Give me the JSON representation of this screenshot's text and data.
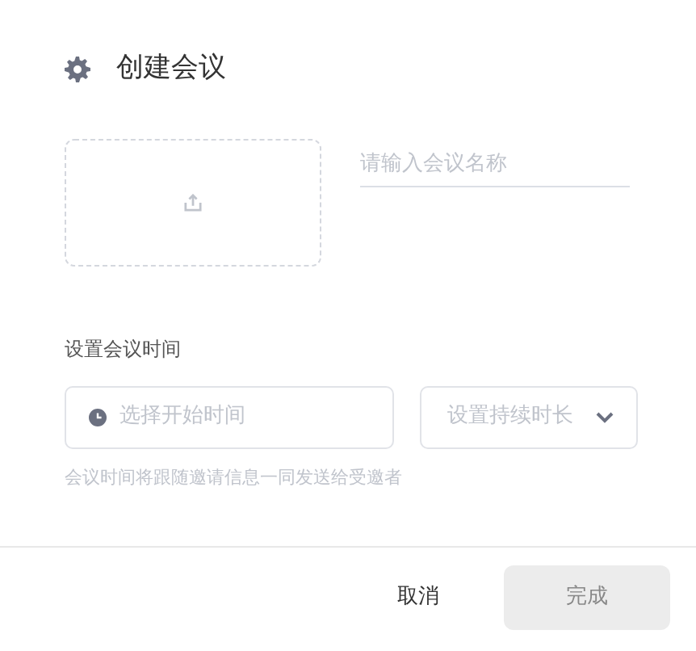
{
  "dialog": {
    "title": "创建会议"
  },
  "name_field": {
    "placeholder": "请输入会议名称"
  },
  "time_section": {
    "label": "设置会议时间",
    "start_field": {
      "placeholder": "选择开始时间"
    },
    "duration_select": {
      "placeholder": "设置持续时长"
    },
    "hint": "会议时间将跟随邀请信息一同发送给受邀者"
  },
  "buttons": [
    {
      "label": "取消",
      "kind": "text",
      "disabled": false
    },
    {
      "label": "完成",
      "kind": "primary",
      "disabled": true
    }
  ]
}
